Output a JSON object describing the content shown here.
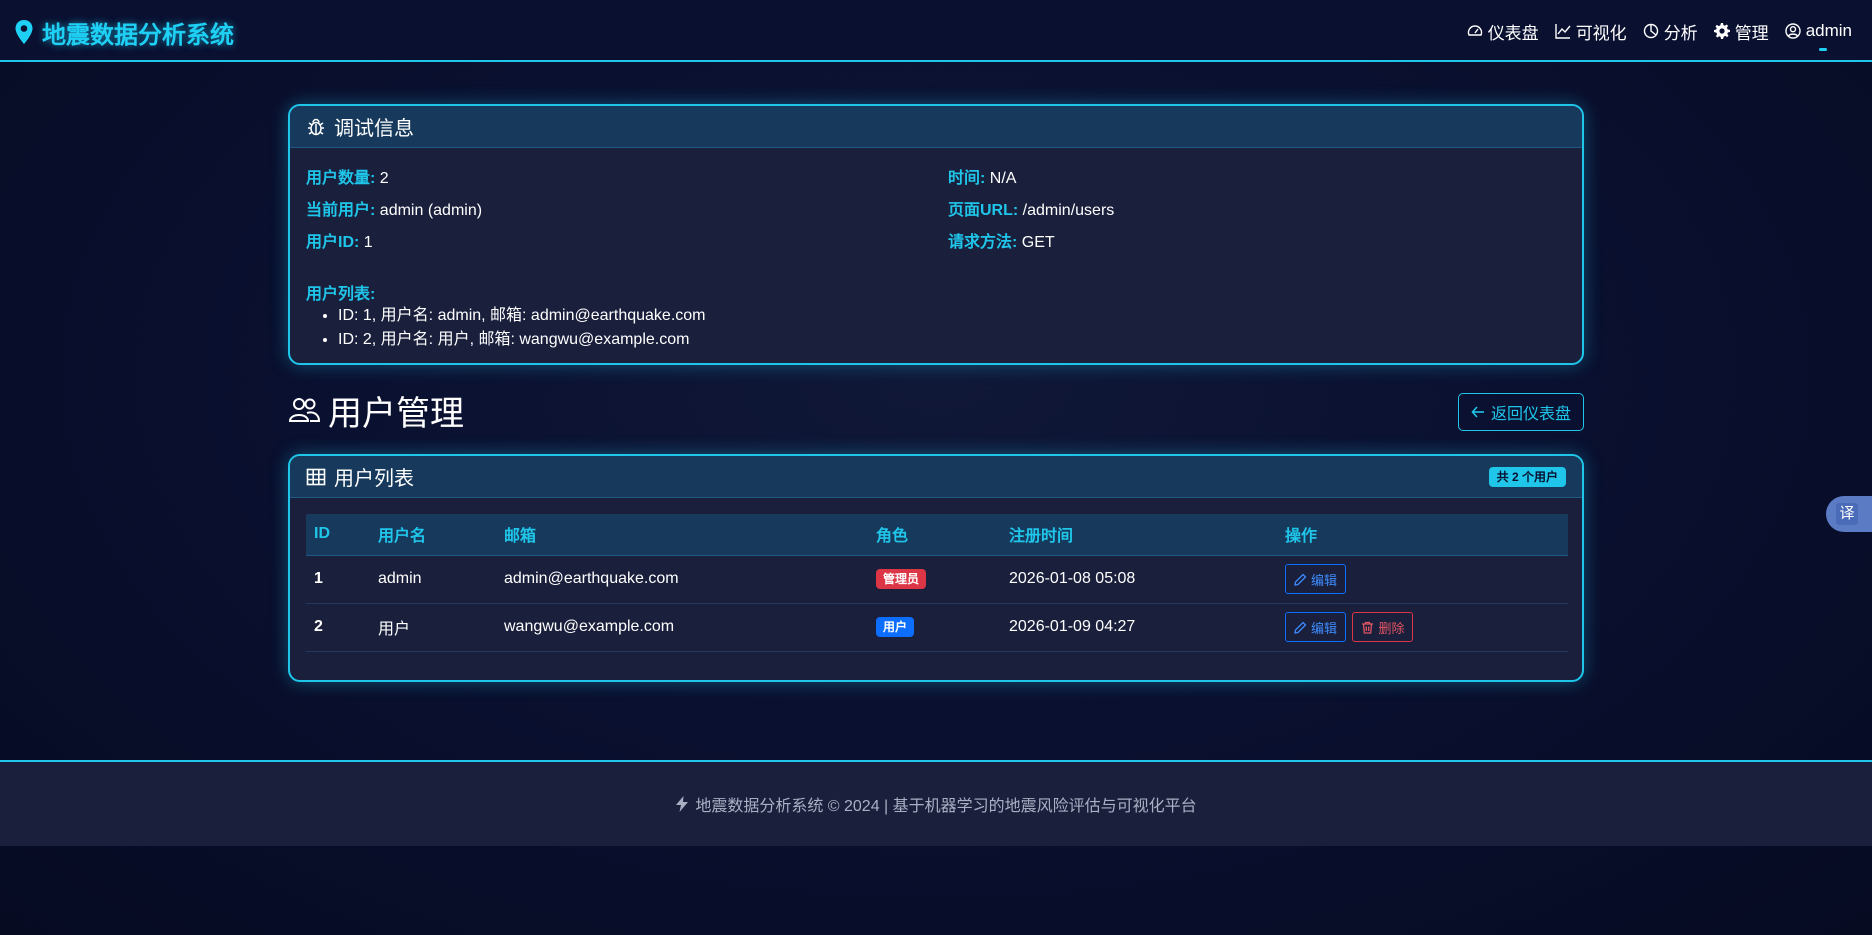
{
  "brand": {
    "title": "地震数据分析系统"
  },
  "nav": {
    "items": [
      {
        "label": "仪表盘",
        "icon": "speedometer-icon"
      },
      {
        "label": "可视化",
        "icon": "line-chart-icon"
      },
      {
        "label": "分析",
        "icon": "pie-chart-icon"
      },
      {
        "label": "管理",
        "icon": "gear-icon"
      },
      {
        "label": "admin",
        "icon": "user-circle-icon"
      }
    ]
  },
  "debug": {
    "title": "调试信息",
    "fields": [
      {
        "key": "用户数量:",
        "value": "2"
      },
      {
        "key": "当前用户:",
        "value": "admin (admin)"
      },
      {
        "key": "用户ID:",
        "value": "1"
      },
      {
        "key": "时间:",
        "value": "N/A"
      },
      {
        "key": "页面URL:",
        "value": "/admin/users"
      },
      {
        "key": "请求方法:",
        "value": "GET"
      }
    ],
    "list_label": "用户列表:",
    "list": [
      "ID: 1, 用户名: admin, 邮箱: admin@earthquake.com",
      "ID: 2, 用户名: 用户, 邮箱: wangwu@example.com"
    ]
  },
  "page": {
    "title": "用户管理",
    "back_button": "返回仪表盘"
  },
  "users": {
    "title": "用户列表",
    "count_badge": "共 2 个用户",
    "columns": [
      "ID",
      "用户名",
      "邮箱",
      "角色",
      "注册时间",
      "操作"
    ],
    "rows": [
      {
        "id": "1",
        "username": "admin",
        "email": "admin@earthquake.com",
        "role": "管理员",
        "registered": "2026-01-08 05:08",
        "edit": "编辑"
      },
      {
        "id": "2",
        "username": "用户",
        "email": "wangwu@example.com",
        "role": "用户",
        "registered": "2026-01-09 04:27",
        "edit": "编辑",
        "delete": "删除"
      }
    ]
  },
  "translate": {
    "label": "译"
  },
  "footer": {
    "text": "地震数据分析系统 © 2024 | 基于机器学习的地震风险评估与可视化平台"
  },
  "colors": {
    "accent": "#1fc6ea",
    "admin_badge": "#dc3545",
    "user_badge": "#0d6efd",
    "background": "#0a1030"
  }
}
